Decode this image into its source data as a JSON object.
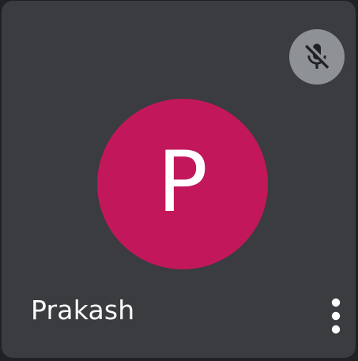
{
  "participant": {
    "name": "Prakash",
    "initial": "P",
    "avatar_color": "#c2185b",
    "muted": true
  },
  "icons": {
    "mute": "mic-off-icon",
    "more": "more-vert-icon"
  },
  "colors": {
    "tile_background": "#3a3c40",
    "page_background": "#202124",
    "mute_badge": "#8e9196",
    "text": "#ffffff"
  }
}
